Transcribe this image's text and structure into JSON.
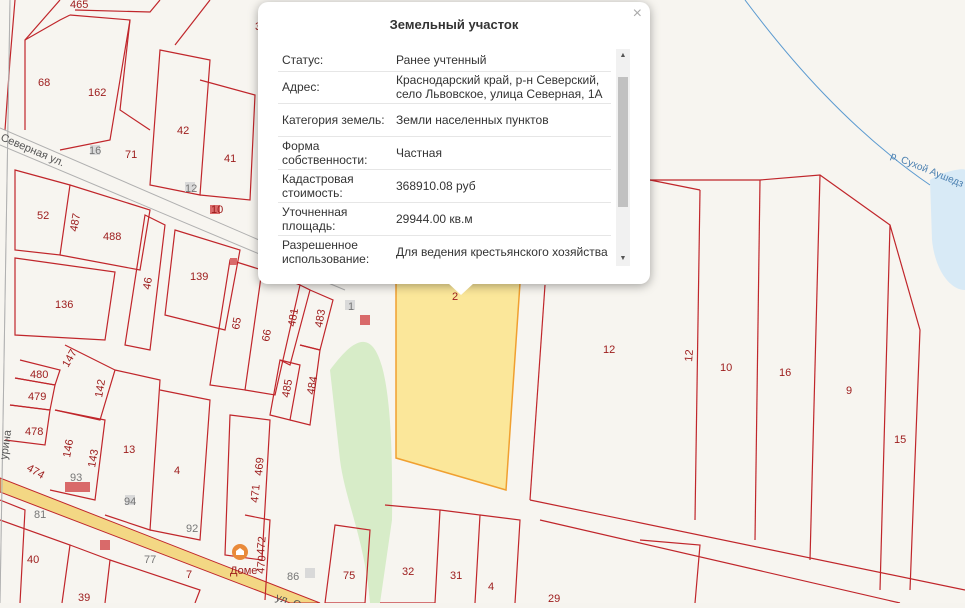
{
  "popup": {
    "title": "Земельный участок",
    "close_glyph": "×",
    "rows": [
      {
        "key": "Статус:",
        "value": "Ранее учтенный"
      },
      {
        "key": "Адрес:",
        "value": "Краснодарский край, р-н Северский, село Львовское, улица Северная, 1А"
      },
      {
        "key": "Категория земель:",
        "value": "Земли населенных пунктов"
      },
      {
        "key": "Форма собственности:",
        "value": "Частная"
      },
      {
        "key": "Кадастровая стоимость:",
        "value": "368910.08 руб"
      },
      {
        "key": "Уточненная площадь:",
        "value": "29944.00 кв.м"
      },
      {
        "key": "Разрешенное использование:",
        "value": "Для ведения крестьянского хозяйства"
      }
    ],
    "scroll_up_glyph": "▲",
    "scroll_down_glyph": "▼"
  },
  "map": {
    "selected_plot_label": "2",
    "street_north": "Северная ул.",
    "street_south": "ул. Се",
    "street_west": "урина",
    "river": "р. Сухой Аушедз",
    "poi_icon": "location-pin-icon",
    "poi_label": "Доме",
    "plot_labels": [
      "465",
      "3",
      "68",
      "162",
      "42",
      "16",
      "71",
      "41",
      "12",
      "10",
      "52",
      "487",
      "488",
      "46",
      "139",
      "136",
      "65",
      "66",
      "481",
      "483",
      "1",
      "147",
      "480",
      "142",
      "485",
      "484",
      "479",
      "478",
      "146",
      "143",
      "13",
      "4",
      "469",
      "471",
      "472",
      "470",
      "474",
      "93",
      "94",
      "92",
      "81",
      "40",
      "77",
      "7",
      "86",
      "75",
      "39",
      "32",
      "31",
      "4",
      "29",
      "12",
      "12",
      "10",
      "16",
      "9",
      "15"
    ]
  },
  "colors": {
    "boundary": "#c0262b",
    "selected_fill": "#fbe79a",
    "green": "#d7ecc8",
    "water": "#d8eaf6",
    "road": "#f3d784"
  }
}
